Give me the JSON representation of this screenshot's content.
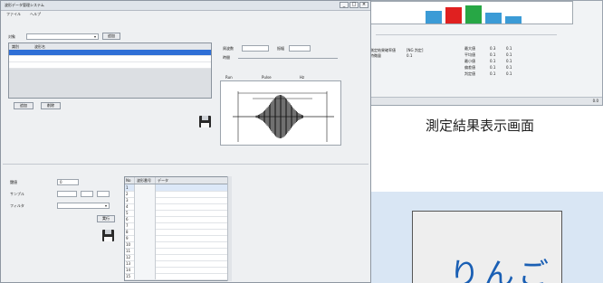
{
  "back_window": {
    "labels": [
      "測定結果確率値",
      "特徴量"
    ],
    "values": [
      "[NG 判定]",
      "0.1"
    ],
    "stats": [
      {
        "name": "最大値",
        "value": "0.3",
        "extra": "0.1"
      },
      {
        "name": "平均値",
        "value": "0.1",
        "extra": "0.1"
      },
      {
        "name": "最小値",
        "value": "0.1",
        "extra": "0.1"
      },
      {
        "name": "偏差値",
        "value": "0.1",
        "extra": "0.1"
      },
      {
        "name": "判定値",
        "value": "0.1",
        "extra": "0.1"
      }
    ],
    "status": "0.0"
  },
  "caption": "測定結果表示画面",
  "apple_text": "りんご",
  "main": {
    "title": "波形データ管理システム",
    "menu": [
      "ファイル",
      "ヘルプ"
    ],
    "top": {
      "label": "対象",
      "select_value": "",
      "button": "追加"
    },
    "list": {
      "headers": [
        "識別",
        "波形名"
      ],
      "rows": [
        {
          "id": "",
          "name": ""
        },
        {
          "id": "",
          "name": ""
        },
        {
          "id": "",
          "name": ""
        }
      ],
      "selected_index": 0
    },
    "buttons": {
      "left": "追加",
      "right": "削除"
    },
    "params": {
      "label_a": "周波数",
      "label_b": "振幅",
      "label_c": "時間"
    },
    "waveform_labels": [
      "Run",
      "Pulse",
      "Hz"
    ],
    "lower_form": {
      "rows": [
        {
          "label": "閾値",
          "value": "0"
        },
        {
          "label": "サンプル",
          "value": ""
        },
        {
          "label": "フィルタ",
          "value": ""
        }
      ],
      "button": "実行"
    },
    "grid": {
      "headers": [
        "No",
        "波形番号",
        "データ"
      ],
      "rows": [
        {
          "no": "1",
          "code": "",
          "data": ""
        },
        {
          "no": "2",
          "code": "",
          "data": ""
        },
        {
          "no": "3",
          "code": "",
          "data": ""
        },
        {
          "no": "4",
          "code": "",
          "data": ""
        },
        {
          "no": "5",
          "code": "",
          "data": ""
        },
        {
          "no": "6",
          "code": "",
          "data": ""
        },
        {
          "no": "7",
          "code": "",
          "data": ""
        },
        {
          "no": "8",
          "code": "",
          "data": ""
        },
        {
          "no": "9",
          "code": "",
          "data": ""
        },
        {
          "no": "10",
          "code": "",
          "data": ""
        },
        {
          "no": "11",
          "code": "",
          "data": ""
        },
        {
          "no": "12",
          "code": "",
          "data": ""
        },
        {
          "no": "13",
          "code": "",
          "data": ""
        },
        {
          "no": "14",
          "code": "",
          "data": ""
        },
        {
          "no": "15",
          "code": "",
          "data": ""
        }
      ]
    }
  },
  "colors": {
    "selection": "#2f6fd6",
    "bar_blue": "#3b9bd6",
    "bar_red": "#e02020",
    "bar_green": "#27a745",
    "caption_panel": "#d9e6f4",
    "apple_text": "#1a5fb4"
  }
}
